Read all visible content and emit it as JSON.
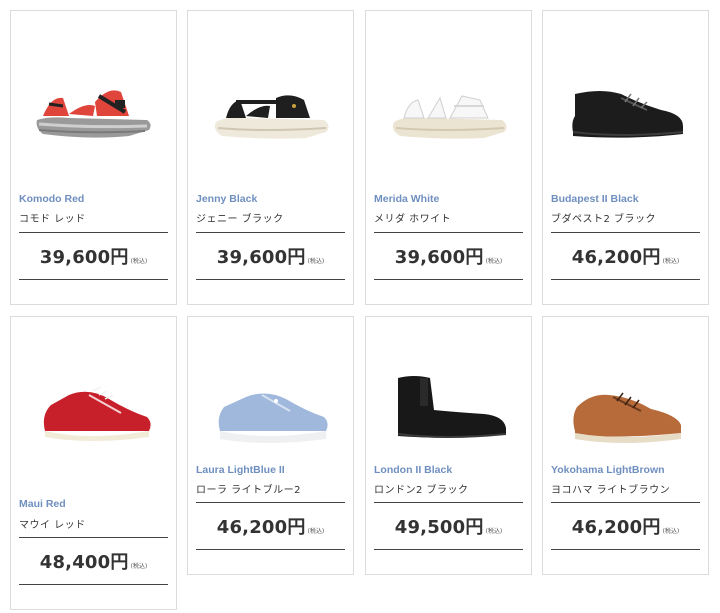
{
  "products": [
    {
      "name_en": "Komodo Red",
      "name_jp": "コモド レッド",
      "price": "39,600円",
      "tax": "(税込)",
      "image": "red-sport-sandal"
    },
    {
      "name_en": "Jenny Black",
      "name_jp": "ジェニー ブラック",
      "price": "39,600円",
      "tax": "(税込)",
      "image": "black-strap-sandal"
    },
    {
      "name_en": "Merida White",
      "name_jp": "メリダ ホワイト",
      "price": "39,600円",
      "tax": "(税込)",
      "image": "white-strap-sandal"
    },
    {
      "name_en": "Budapest II  Black",
      "name_jp": "ブダペスト2 ブラック",
      "price": "46,200円",
      "tax": "(税込)",
      "image": "black-leather-shoe"
    },
    {
      "name_en": "Maui Red",
      "name_jp": "マウイ レッド",
      "price": "48,400円",
      "tax": "(税込)",
      "image": "red-sneaker"
    },
    {
      "name_en": "Laura LightBlue II",
      "name_jp": "ローラ ライトブルー2",
      "price": "46,200円",
      "tax": "(税込)",
      "image": "lightblue-sneaker"
    },
    {
      "name_en": "London II Black",
      "name_jp": "ロンドン2 ブラック",
      "price": "49,500円",
      "tax": "(税込)",
      "image": "black-chelsea-boot"
    },
    {
      "name_en": "Yokohama LightBrown",
      "name_jp": "ヨコハマ ライトブラウン",
      "price": "46,200円",
      "tax": "(税込)",
      "image": "brown-leather-shoe"
    }
  ]
}
